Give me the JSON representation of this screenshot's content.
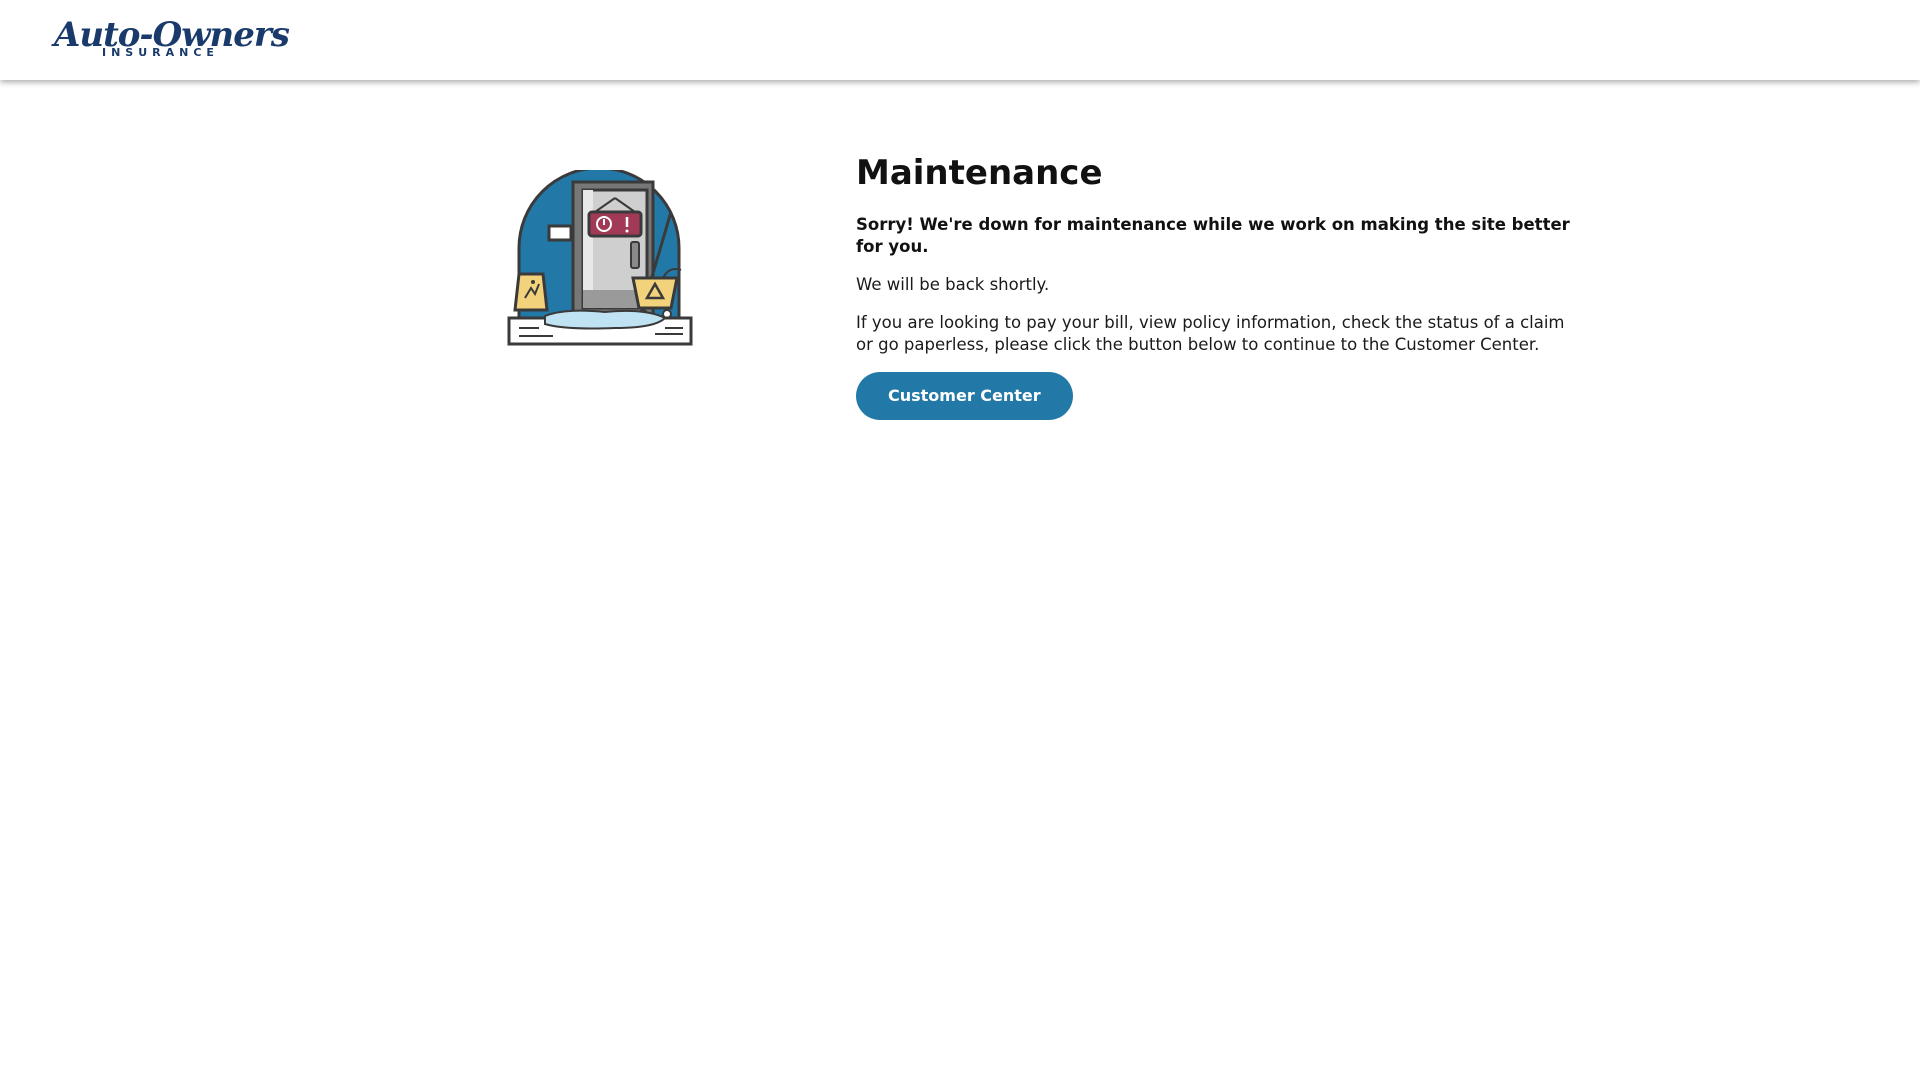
{
  "header": {
    "logo": {
      "brand": "Auto-Owners",
      "tagline": "INSURANCE"
    }
  },
  "main": {
    "title": "Maintenance",
    "lead": "Sorry! We're down for maintenance while we work on making the site better for you.",
    "back_shortly": "We will be back shortly.",
    "info": "If you are looking to pay your bill, view policy information, check the status of a claim or go paperless, please click the button below to continue to the Customer Center.",
    "button_label": "Customer Center"
  },
  "colors": {
    "brand": "#1a3a6b",
    "button": "#2279a8",
    "illustration_circle": "#2279a8",
    "sign": "#a23a55",
    "bucket": "#f2d27a"
  },
  "icons": {
    "illustration": "maintenance-door-illustration"
  }
}
